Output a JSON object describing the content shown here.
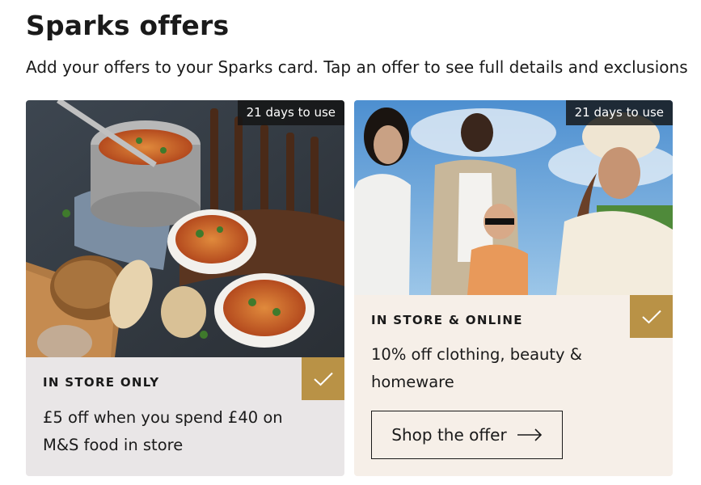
{
  "page": {
    "title": "Sparks offers",
    "subtitle": "Add your offers to your Sparks card. Tap an offer to see full details and exclusions"
  },
  "offers": [
    {
      "days_badge": "21 days to use",
      "channel": "IN STORE ONLY",
      "description": "£5 off when you spend £40 on M&S food in store",
      "added": true,
      "image_subject": "food-soup-bread-photo"
    },
    {
      "days_badge": "21 days to use",
      "channel": "IN STORE & ONLINE",
      "description": "10% off clothing, beauty & homeware",
      "cta_label": "Shop the offer",
      "added": true,
      "image_subject": "fashion-models-photo"
    }
  ],
  "colors": {
    "accent_gold": "#b99246",
    "badge_bg": "#141414",
    "text": "#1a1a1a"
  },
  "icons": {
    "check": "check-icon",
    "arrow": "arrow-right-icon"
  }
}
